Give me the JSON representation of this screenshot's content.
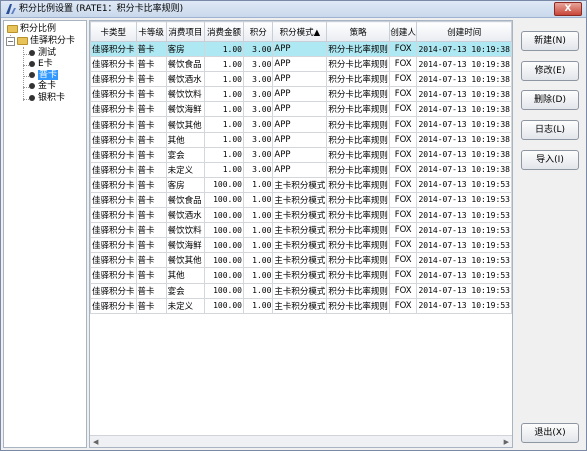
{
  "window": {
    "title": "积分比例设置 (RATE1：积分卡比率规则)",
    "close_label": "X"
  },
  "tree": {
    "root": "积分比例",
    "group": "佳驿积分卡",
    "items": [
      "测试",
      "E卡",
      "普卡",
      "金卡",
      "银积卡"
    ]
  },
  "table": {
    "columns": [
      "卡类型",
      "卡等级",
      "消费项目",
      "消费金额",
      "积分",
      "积分模式▲",
      "策略",
      "创建人",
      "创建时间"
    ],
    "rows": [
      [
        "佳驿积分卡",
        "普卡",
        "客房",
        "1.00",
        "3.00",
        "APP",
        "积分卡比率规则",
        "FOX",
        "2014-07-13 10:19:38"
      ],
      [
        "佳驿积分卡",
        "普卡",
        "餐饮食品",
        "1.00",
        "3.00",
        "APP",
        "积分卡比率规则",
        "FOX",
        "2014-07-13 10:19:38"
      ],
      [
        "佳驿积分卡",
        "普卡",
        "餐饮酒水",
        "1.00",
        "3.00",
        "APP",
        "积分卡比率规则",
        "FOX",
        "2014-07-13 10:19:38"
      ],
      [
        "佳驿积分卡",
        "普卡",
        "餐饮饮料",
        "1.00",
        "3.00",
        "APP",
        "积分卡比率规则",
        "FOX",
        "2014-07-13 10:19:38"
      ],
      [
        "佳驿积分卡",
        "普卡",
        "餐饮海鲜",
        "1.00",
        "3.00",
        "APP",
        "积分卡比率规则",
        "FOX",
        "2014-07-13 10:19:38"
      ],
      [
        "佳驿积分卡",
        "普卡",
        "餐饮其他",
        "1.00",
        "3.00",
        "APP",
        "积分卡比率规则",
        "FOX",
        "2014-07-13 10:19:38"
      ],
      [
        "佳驿积分卡",
        "普卡",
        "其他",
        "1.00",
        "3.00",
        "APP",
        "积分卡比率规则",
        "FOX",
        "2014-07-13 10:19:38"
      ],
      [
        "佳驿积分卡",
        "普卡",
        "宴会",
        "1.00",
        "3.00",
        "APP",
        "积分卡比率规则",
        "FOX",
        "2014-07-13 10:19:38"
      ],
      [
        "佳驿积分卡",
        "普卡",
        "未定义",
        "1.00",
        "3.00",
        "APP",
        "积分卡比率规则",
        "FOX",
        "2014-07-13 10:19:38"
      ],
      [
        "佳驿积分卡",
        "普卡",
        "客房",
        "100.00",
        "1.00",
        "主卡积分模式",
        "积分卡比率规则",
        "FOX",
        "2014-07-13 10:19:53"
      ],
      [
        "佳驿积分卡",
        "普卡",
        "餐饮食品",
        "100.00",
        "1.00",
        "主卡积分模式",
        "积分卡比率规则",
        "FOX",
        "2014-07-13 10:19:53"
      ],
      [
        "佳驿积分卡",
        "普卡",
        "餐饮酒水",
        "100.00",
        "1.00",
        "主卡积分模式",
        "积分卡比率规则",
        "FOX",
        "2014-07-13 10:19:53"
      ],
      [
        "佳驿积分卡",
        "普卡",
        "餐饮饮料",
        "100.00",
        "1.00",
        "主卡积分模式",
        "积分卡比率规则",
        "FOX",
        "2014-07-13 10:19:53"
      ],
      [
        "佳驿积分卡",
        "普卡",
        "餐饮海鲜",
        "100.00",
        "1.00",
        "主卡积分模式",
        "积分卡比率规则",
        "FOX",
        "2014-07-13 10:19:53"
      ],
      [
        "佳驿积分卡",
        "普卡",
        "餐饮其他",
        "100.00",
        "1.00",
        "主卡积分模式",
        "积分卡比率规则",
        "FOX",
        "2014-07-13 10:19:53"
      ],
      [
        "佳驿积分卡",
        "普卡",
        "其他",
        "100.00",
        "1.00",
        "主卡积分模式",
        "积分卡比率规则",
        "FOX",
        "2014-07-13 10:19:53"
      ],
      [
        "佳驿积分卡",
        "普卡",
        "宴会",
        "100.00",
        "1.00",
        "主卡积分模式",
        "积分卡比率规则",
        "FOX",
        "2014-07-13 10:19:53"
      ],
      [
        "佳驿积分卡",
        "普卡",
        "未定义",
        "100.00",
        "1.00",
        "主卡积分模式",
        "积分卡比率规则",
        "FOX",
        "2014-07-13 10:19:53"
      ]
    ],
    "selected_row": 0
  },
  "buttons": {
    "new": "新建(N)",
    "edit": "修改(E)",
    "delete": "删除(D)",
    "log": "日志(L)",
    "import": "导入(I)",
    "exit": "退出(X)"
  },
  "colors": {
    "selected_row": "#aee8f2",
    "tree_selection": "#3399ff"
  }
}
